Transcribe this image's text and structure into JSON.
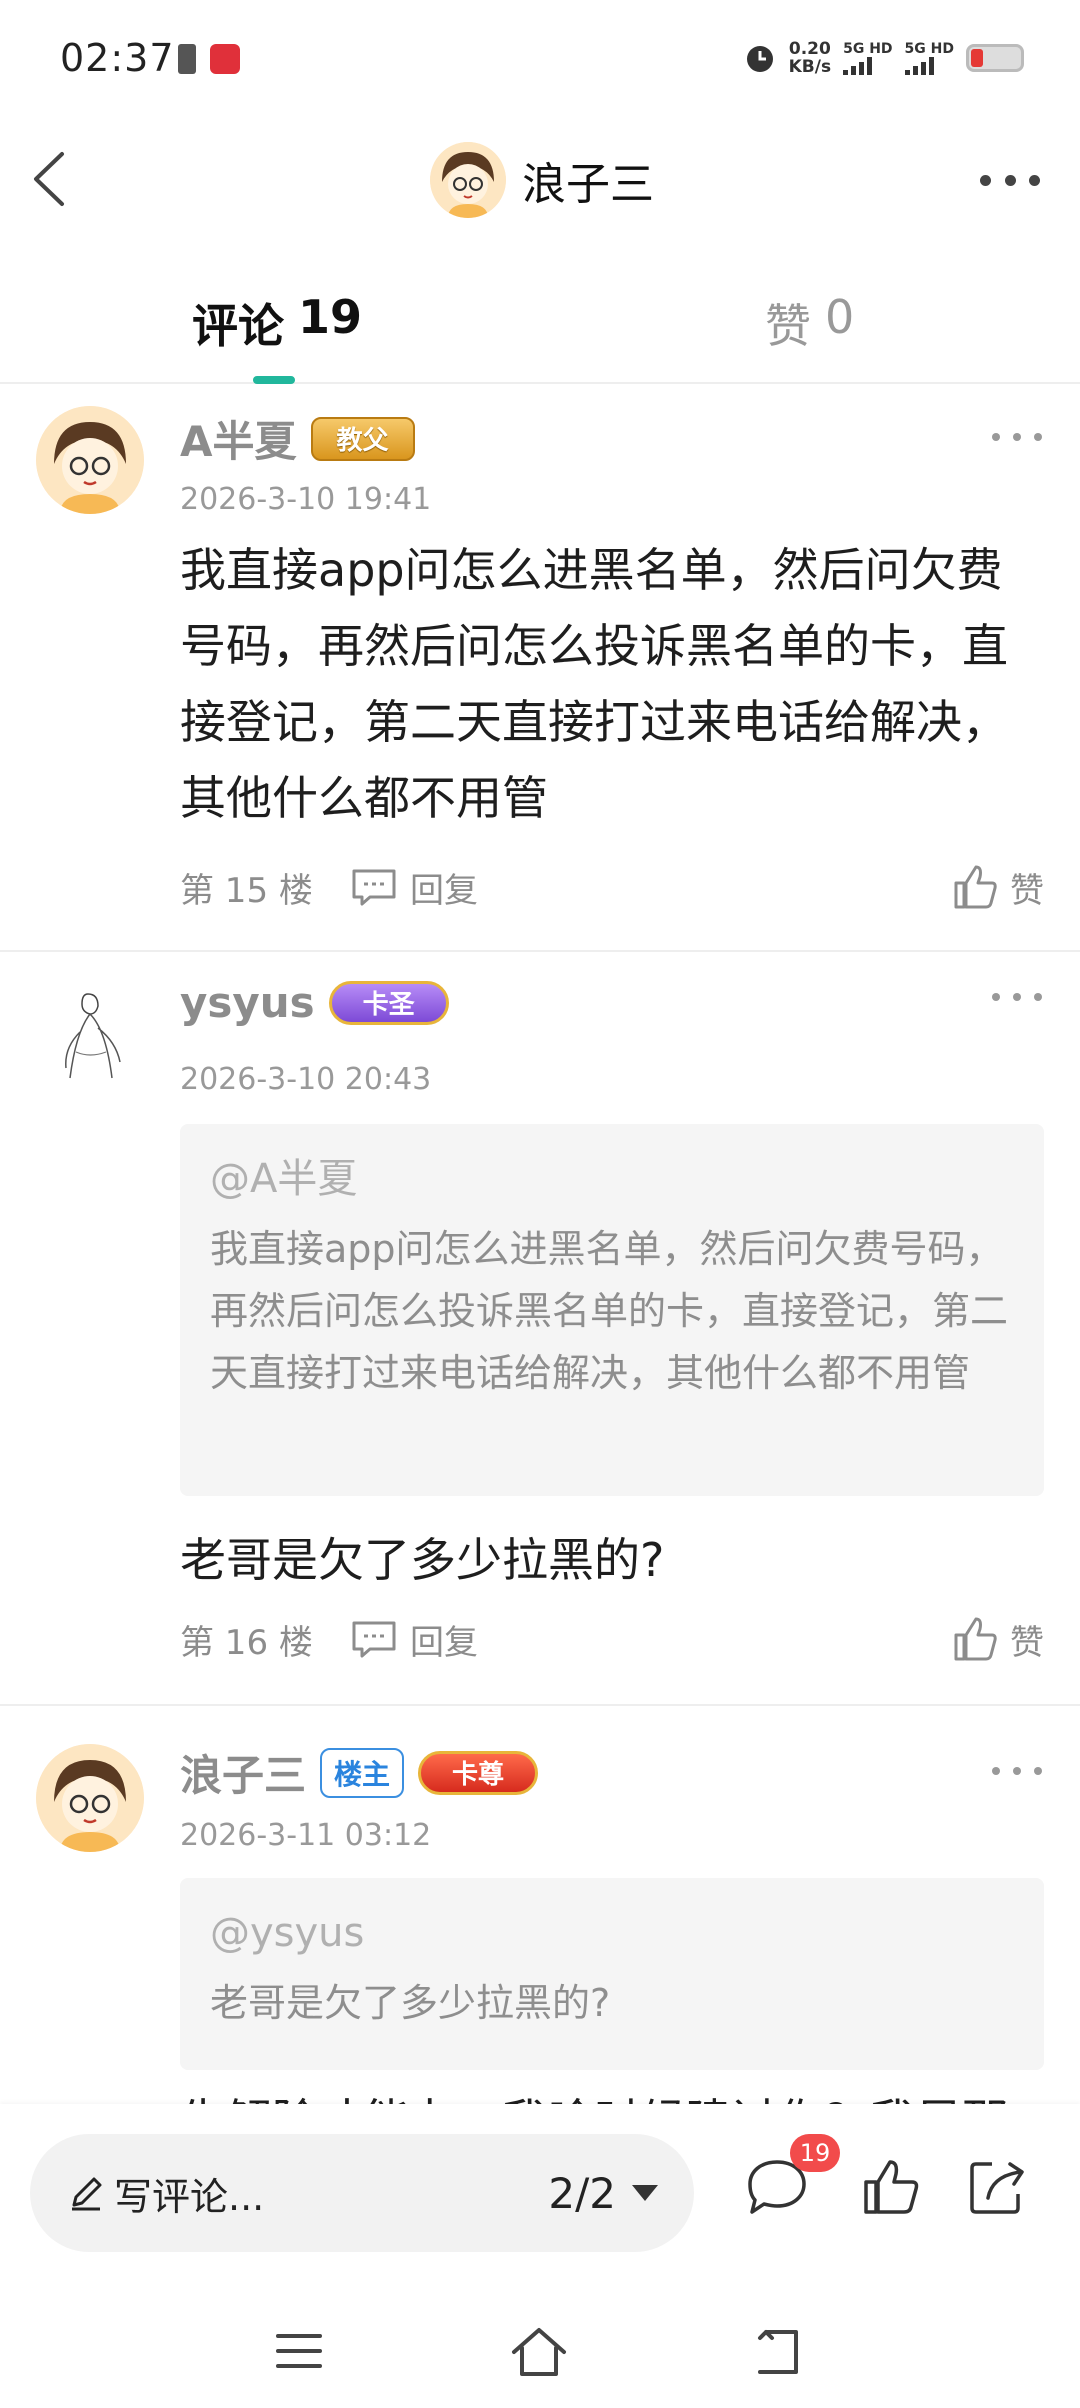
{
  "status_bar": {
    "time": "02:37",
    "net_speed": "0.20",
    "net_unit": "KB/s",
    "sim1": "5G HD",
    "sim2": "5G HD"
  },
  "header": {
    "author": "浪子三",
    "back_icon": "chevron-left-icon",
    "more_icon": "more-horizontal-icon"
  },
  "tabs": [
    {
      "label": "评论",
      "count": "19"
    },
    {
      "label": "赞",
      "count": "0"
    }
  ],
  "comments": [
    {
      "user": "A半夏",
      "badges": [
        "教父"
      ],
      "time": "2026-3-10 19:41",
      "text": "我直接app问怎么进黑名单，然后问欠费号码，再然后问怎么投诉黑名单的卡，直接登记，第二天直接打过来电话给解决，其他什么都不用管",
      "floor": "第 15 楼",
      "reply_label": "回复",
      "like_label": "赞"
    },
    {
      "user": "ysyus",
      "badges": [
        "卡圣"
      ],
      "time": "2026-3-10 20:43",
      "quote_at": "@A半夏",
      "quote_text": "我直接app问怎么进黑名单，然后问欠费号码，再然后问怎么投诉黑名单的卡，直接登记，第二天直接打过来电话给解决，其他什么都不用管",
      "text": "老哥是欠了多少拉黑的?",
      "floor": "第 16 楼",
      "reply_label": "回复",
      "like_label": "赞"
    },
    {
      "user": "浪子三",
      "badges": [
        "楼主",
        "卡尊"
      ],
      "time": "2026-3-11 03:12",
      "quote_at": "@ysyus",
      "quote_text": "老哥是欠了多少拉黑的?",
      "text": "生解除才能办，我啥时候建过你？我早那"
    }
  ],
  "bottom_bar": {
    "input_placeholder": "写评论...",
    "page_indicator": "2/2",
    "comment_count": "19"
  },
  "colors": {
    "accent": "#21b79c",
    "badge_red": "#f24b4b",
    "owner_blue": "#2a84de"
  }
}
